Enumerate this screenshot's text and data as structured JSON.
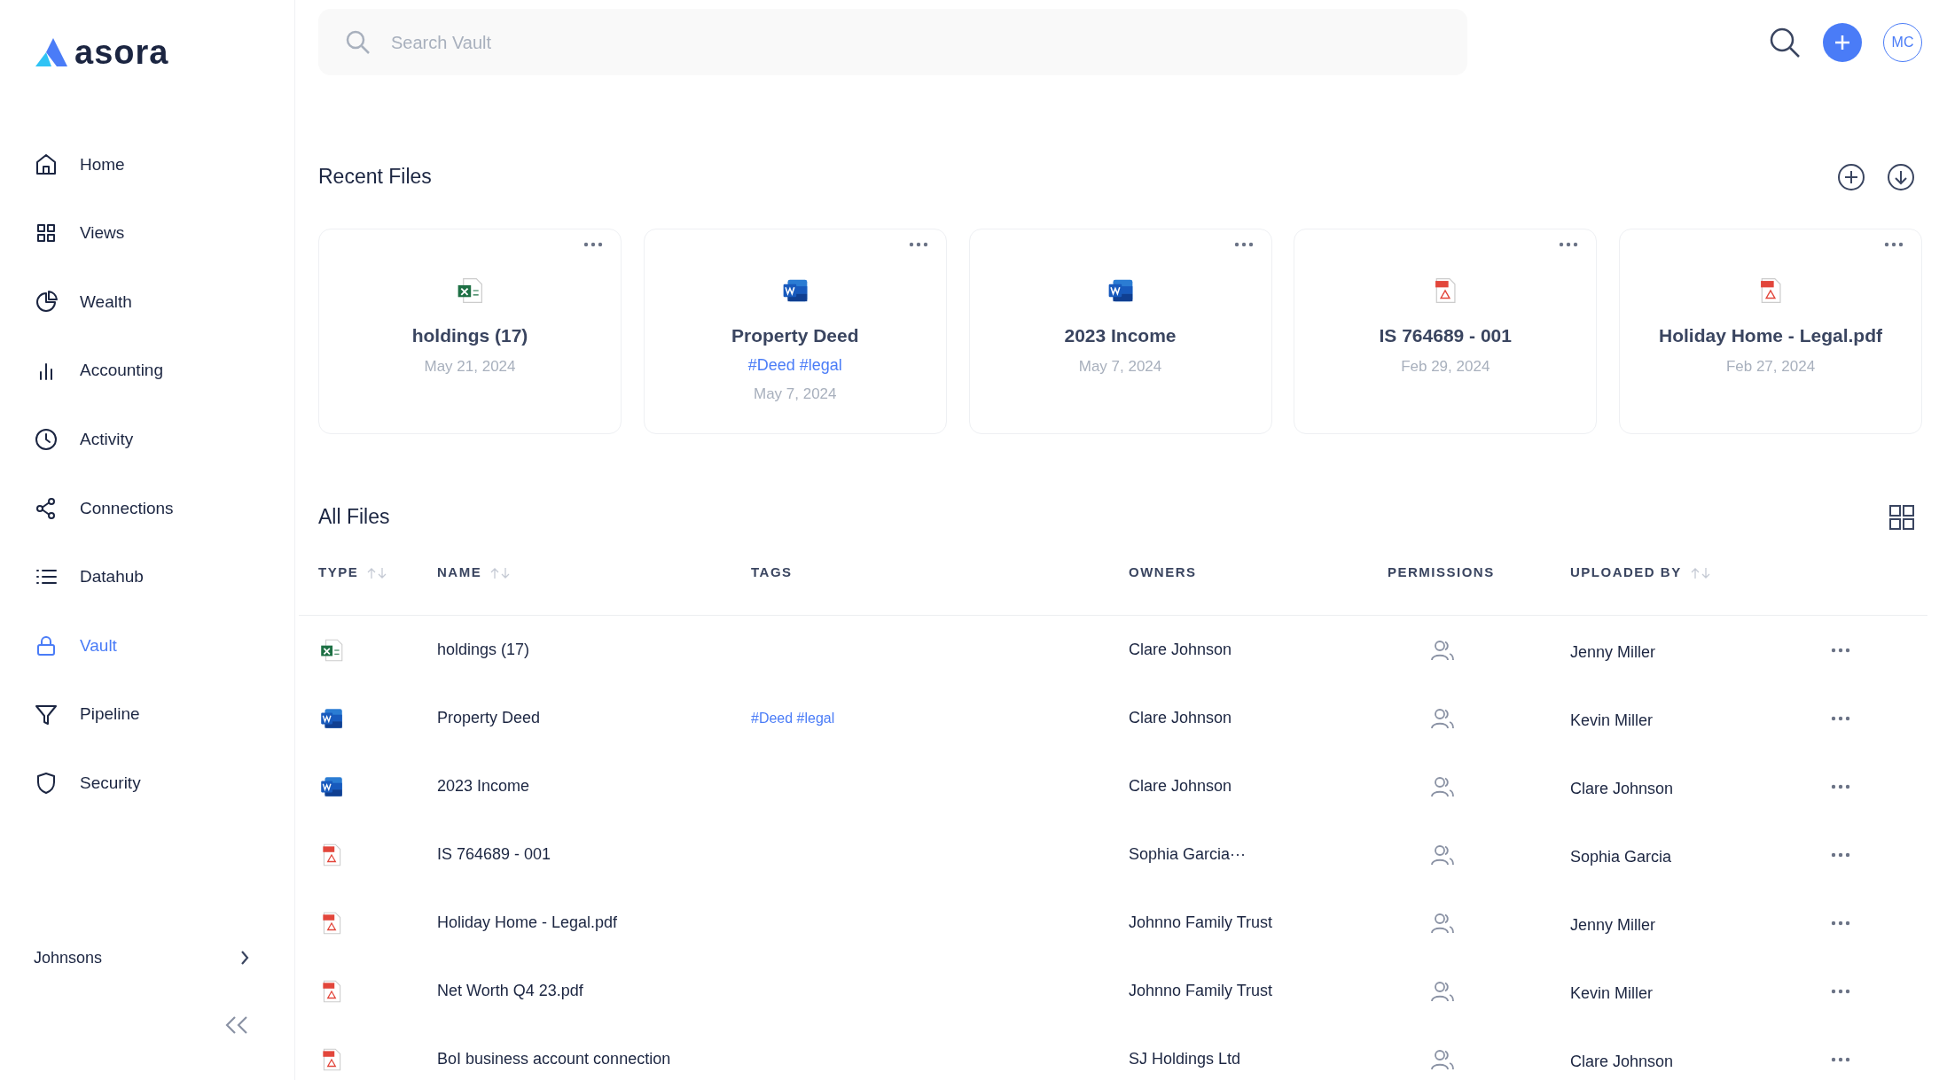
{
  "sidebar": {
    "logo": "asora",
    "items": [
      {
        "label": "Home",
        "selected": false
      },
      {
        "label": "Views",
        "selected": false
      },
      {
        "label": "Wealth",
        "selected": false
      },
      {
        "label": "Accounting",
        "selected": false
      },
      {
        "label": "Activity",
        "selected": false
      },
      {
        "label": "Connections",
        "selected": false
      },
      {
        "label": "Datahub",
        "selected": false
      },
      {
        "label": "Vault",
        "selected": true
      },
      {
        "label": "Pipeline",
        "selected": false
      },
      {
        "label": "Security",
        "selected": false
      }
    ],
    "workspace": "Johnsons"
  },
  "search": {
    "placeholder": "Search Vault"
  },
  "avatar": "MC",
  "recent_files": {
    "title": "Recent Files",
    "cards": [
      {
        "kind": "excel",
        "name": "holdings (17)",
        "date": "May 21, 2024"
      },
      {
        "kind": "word",
        "name": "Property Deed",
        "tags": "#Deed #legal",
        "date": "May 7, 2024"
      },
      {
        "kind": "word",
        "name": "2023 Income",
        "date": "May 7, 2024"
      },
      {
        "kind": "pdf",
        "name": "IS 764689 - 001",
        "date": "Feb 29, 2024"
      },
      {
        "kind": "pdf",
        "name": "Holiday Home - Legal.pdf",
        "date": "Feb 27, 2024"
      }
    ]
  },
  "all_files": {
    "title": "All Files",
    "columns": [
      {
        "label": "TYPE",
        "sortable": true
      },
      {
        "label": "NAME",
        "sortable": true
      },
      {
        "label": "TAGS",
        "sortable": false
      },
      {
        "label": "OWNERS",
        "sortable": false
      },
      {
        "label": "PERMISSIONS",
        "sortable": false
      },
      {
        "label": "UPLOADED BY",
        "sortable": true
      }
    ],
    "rows": [
      {
        "kind": "excel",
        "name": "holdings (17)",
        "owner": "Clare Johnson",
        "uploaded_by": "Jenny Miller"
      },
      {
        "kind": "word",
        "name": "Property Deed",
        "tags": "#Deed #legal",
        "owner": "Clare Johnson",
        "uploaded_by": "Kevin Miller"
      },
      {
        "kind": "word",
        "name": "2023 Income",
        "owner": "Clare Johnson",
        "uploaded_by": "Clare Johnson"
      },
      {
        "kind": "pdf",
        "name": "IS 764689 - 001",
        "owner": "Sophia Garcia···",
        "uploaded_by": "Sophia Garcia"
      },
      {
        "kind": "pdf",
        "name": "Holiday Home - Legal.pdf",
        "owner": "Johnno Family Trust",
        "uploaded_by": "Jenny Miller"
      },
      {
        "kind": "pdf",
        "name": "Net Worth Q4 23.pdf",
        "owner": "Johnno Family Trust",
        "uploaded_by": "Kevin Miller"
      },
      {
        "kind": "pdf",
        "name": "BoI business account connection",
        "owner": "SJ Holdings Ltd",
        "uploaded_by": "Clare Johnson"
      }
    ]
  }
}
